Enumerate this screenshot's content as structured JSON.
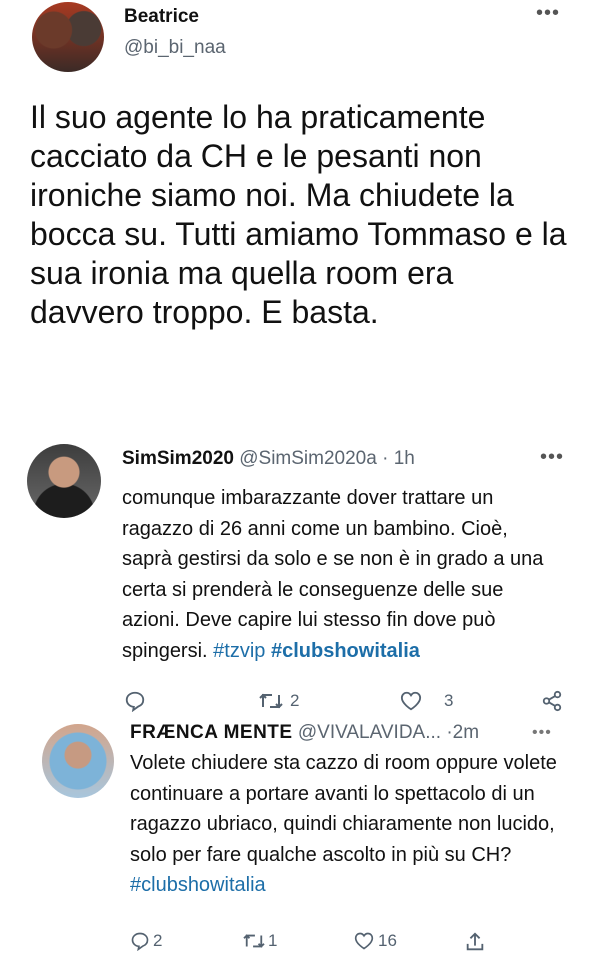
{
  "main_tweet": {
    "display_name": "Beatrice",
    "handle": "@bi_bi_naa",
    "text": "Il suo agente lo ha praticamente cacciato da CH e le pesanti non ironiche siamo noi. Ma chiudete la bocca su. Tutti amiamo Tommaso e la sua ironia ma quella room era davvero troppo. E basta."
  },
  "reply1": {
    "display_name": "SimSim2020",
    "handle": "@SimSim2020a",
    "time": "· 1h",
    "text": "comunque imbarazzante dover trattare un ragazzo di 26 anni come un bambino. Cioè, saprà gestirsi da solo e se non è in grado a una certa si prenderà le conseguenze delle sue azioni. Deve capire lui stesso fin dove può spingersi.",
    "hashtag1": "#tzvip",
    "hashtag2": "#clubshowitalia",
    "retweets": "2",
    "likes": "3"
  },
  "reply2": {
    "display_name": "FRÆNCA MENTE",
    "handle": "@VIVALAVIDA...",
    "time": "·2m",
    "text": "Volete chiudere sta cazzo di room oppure volete continuare a portare avanti lo spettacolo di un ragazzo ubriaco, quindi chiaramente non lucido, solo per fare qualche ascolto in più su CH?",
    "hashtag": "#clubshowitalia",
    "replies": "2",
    "retweets": "1",
    "likes": "16"
  },
  "icons": {
    "more": "more-icon",
    "reply": "reply-icon",
    "retweet": "retweet-icon",
    "like": "like-icon",
    "share": "share-icon"
  },
  "colors": {
    "link": "#1d6ea8",
    "muted": "#5b6570"
  }
}
